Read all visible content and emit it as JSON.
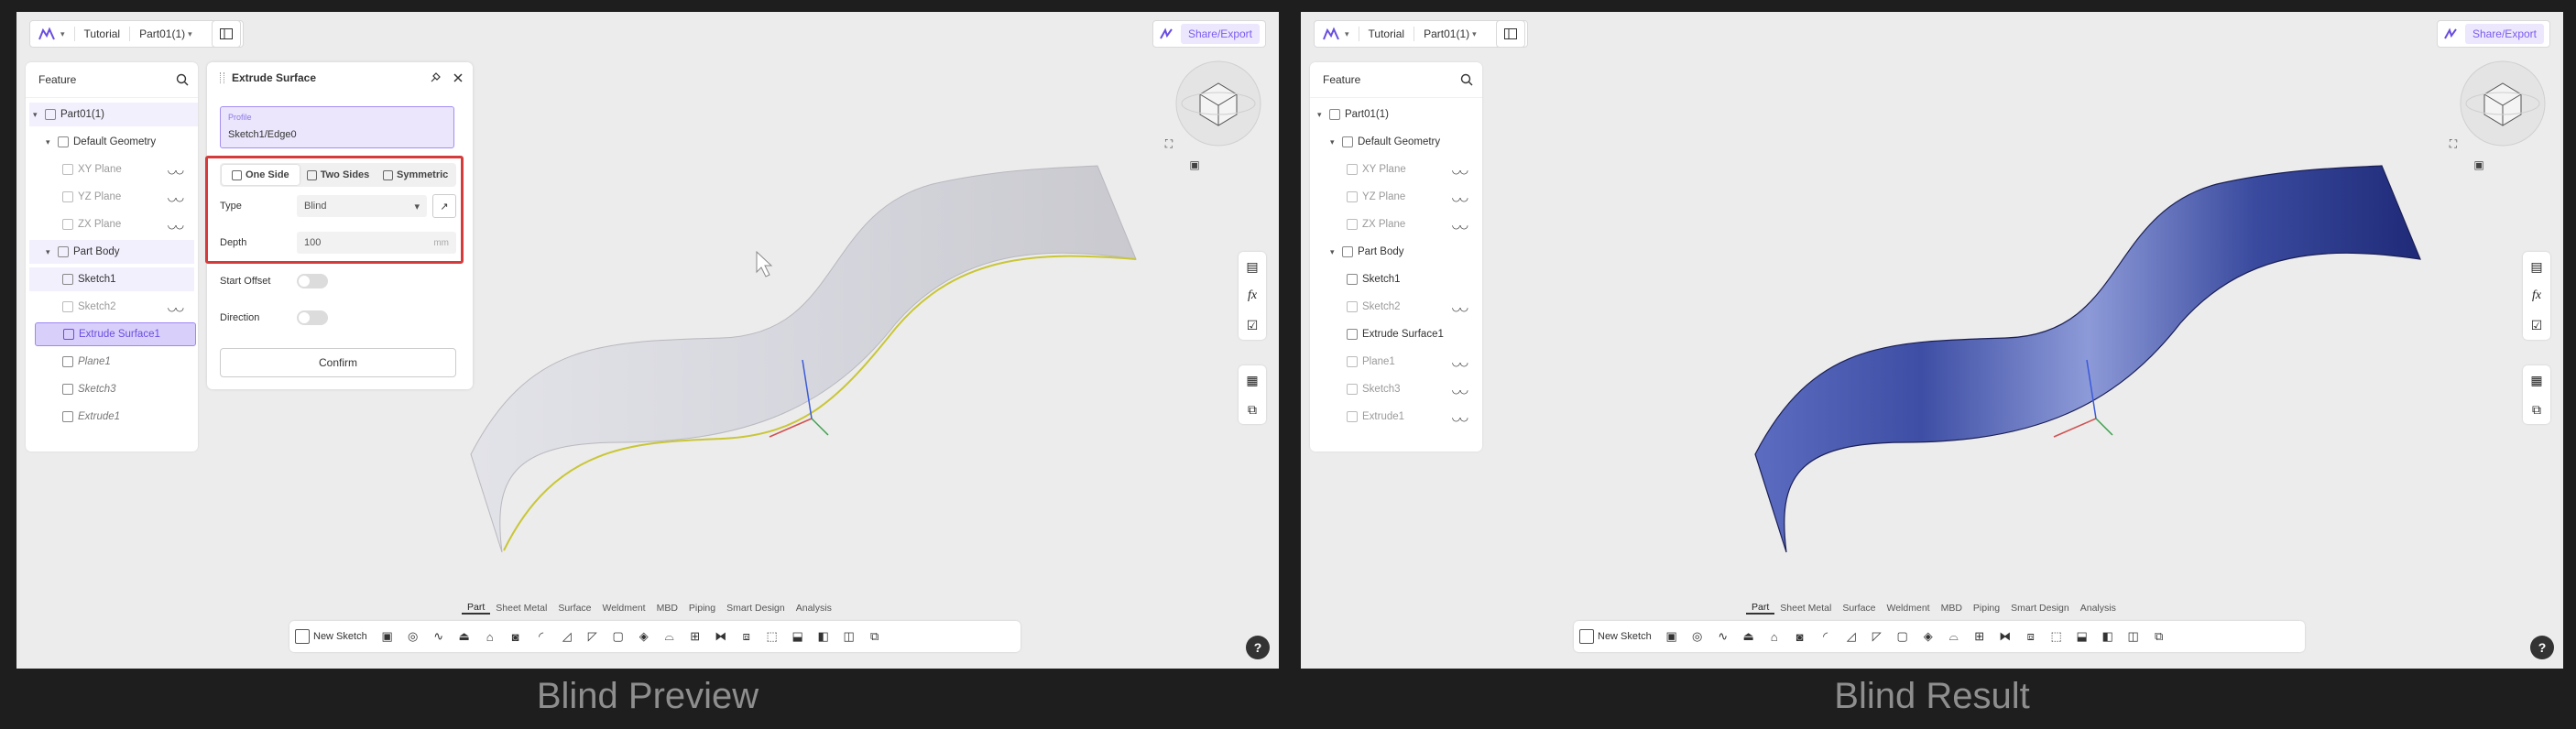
{
  "left": {
    "caption": "Blind Preview",
    "topbar": {
      "project": "Tutorial",
      "part": "Part01(1)",
      "share": "Share/Export"
    },
    "feature": {
      "title": "Feature",
      "tree": [
        {
          "label": "Part01(1)",
          "eye": ""
        },
        {
          "label": "Default Geometry",
          "eye": ""
        },
        {
          "label": "XY Plane",
          "eye": "◡◡"
        },
        {
          "label": "YZ Plane",
          "eye": "◡◡"
        },
        {
          "label": "ZX Plane",
          "eye": "◡◡"
        },
        {
          "label": "Part Body",
          "eye": ""
        },
        {
          "label": "Sketch1",
          "eye": ""
        },
        {
          "label": "Sketch2",
          "eye": "◡◡"
        },
        {
          "label": "Extrude Surface1",
          "eye": ""
        },
        {
          "label": "Plane1",
          "eye": ""
        },
        {
          "label": "Sketch3",
          "eye": ""
        },
        {
          "label": "Extrude1",
          "eye": ""
        }
      ]
    },
    "dialog": {
      "title": "Extrude Surface",
      "profile_label": "Profile",
      "profile_value": "Sketch1/Edge0",
      "options": [
        "One Side",
        "Two Sides",
        "Symmetric"
      ],
      "type_label": "Type",
      "type_value": "Blind",
      "depth_label": "Depth",
      "depth_value": "100",
      "depth_unit": "mm",
      "start_offset_label": "Start Offset",
      "direction_label": "Direction",
      "confirm": "Confirm"
    },
    "tabs": [
      "Part",
      "Sheet Metal",
      "Surface",
      "Weldment",
      "MBD",
      "Piping",
      "Smart Design",
      "Analysis"
    ],
    "new_sketch": "New Sketch",
    "help": "?"
  },
  "right": {
    "caption": "Blind Result",
    "topbar": {
      "project": "Tutorial",
      "part": "Part01(1)",
      "share": "Share/Export"
    },
    "feature": {
      "title": "Feature",
      "tree": [
        {
          "label": "Part01(1)",
          "eye": ""
        },
        {
          "label": "Default Geometry",
          "eye": ""
        },
        {
          "label": "XY Plane",
          "eye": "◡◡"
        },
        {
          "label": "YZ Plane",
          "eye": "◡◡"
        },
        {
          "label": "ZX Plane",
          "eye": "◡◡"
        },
        {
          "label": "Part Body",
          "eye": ""
        },
        {
          "label": "Sketch1",
          "eye": ""
        },
        {
          "label": "Sketch2",
          "eye": "◡◡"
        },
        {
          "label": "Extrude Surface1",
          "eye": ""
        },
        {
          "label": "Plane1",
          "eye": "◡◡"
        },
        {
          "label": "Sketch3",
          "eye": "◡◡"
        },
        {
          "label": "Extrude1",
          "eye": "◡◡"
        }
      ]
    },
    "tabs": [
      "Part",
      "Sheet Metal",
      "Surface",
      "Weldment",
      "MBD",
      "Piping",
      "Smart Design",
      "Analysis"
    ],
    "new_sketch": "New Sketch",
    "help": "?"
  },
  "colors": {
    "accent": "#7b5cf0",
    "highlight_box": "#d63b3b",
    "preview_surface": "#dcdde3",
    "preview_edge": "#c8c83a",
    "result_surface": "#3a4a9e"
  }
}
